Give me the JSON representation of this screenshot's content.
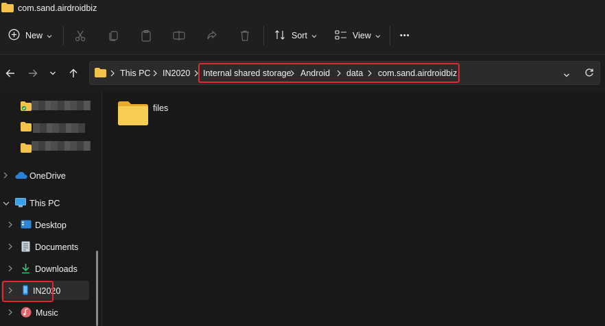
{
  "window": {
    "title": "com.sand.airdroidbiz"
  },
  "toolbar": {
    "new_label": "New",
    "sort_label": "Sort",
    "view_label": "View",
    "more_label": "•••"
  },
  "address": {
    "crumbs": [
      "This PC",
      "IN2020",
      "Internal shared storage",
      "Android",
      "data",
      "com.sand.airdroidbiz"
    ]
  },
  "sidebar": {
    "items": [
      {
        "label": "OneDrive"
      },
      {
        "label": "This PC"
      },
      {
        "label": "Desktop"
      },
      {
        "label": "Documents"
      },
      {
        "label": "Downloads"
      },
      {
        "label": "IN2020"
      },
      {
        "label": "Music"
      }
    ]
  },
  "content": {
    "files": [
      {
        "name": "files",
        "type": "folder"
      }
    ]
  },
  "colors": {
    "highlight": "#e8262b",
    "folder": "#f3c24a",
    "background": "#191919"
  }
}
